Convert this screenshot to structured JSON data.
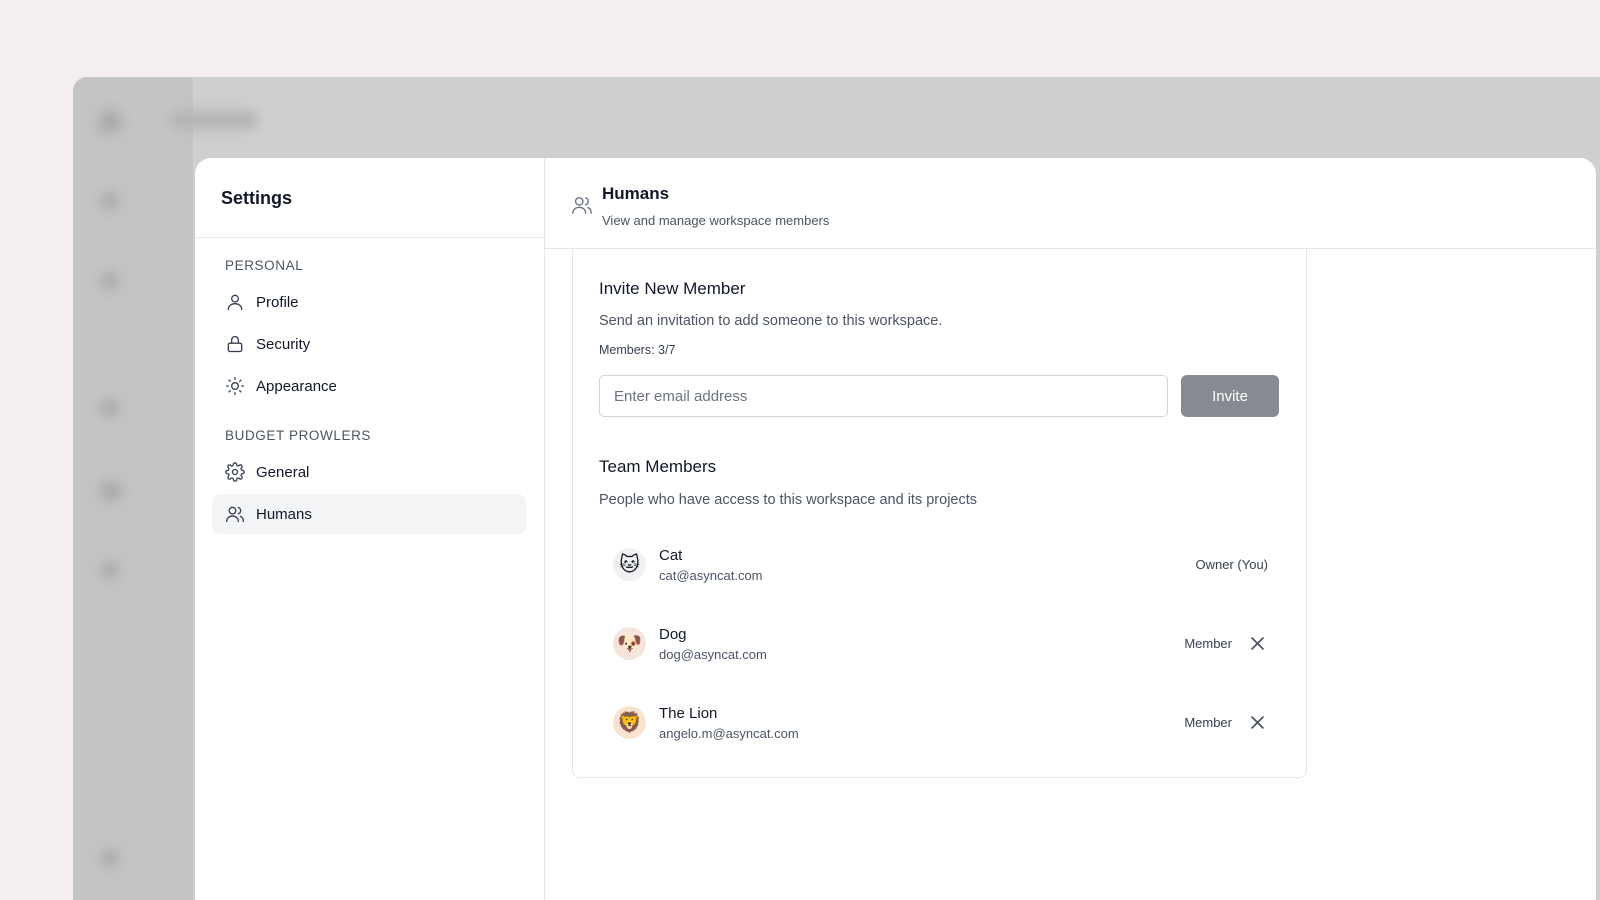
{
  "settings": {
    "title": "Settings",
    "sections": [
      {
        "label": "PERSONAL",
        "items": [
          {
            "label": "Profile",
            "icon": "user-icon"
          },
          {
            "label": "Security",
            "icon": "lock-icon"
          },
          {
            "label": "Appearance",
            "icon": "sun-icon"
          }
        ]
      },
      {
        "label": "BUDGET PROWLERS",
        "items": [
          {
            "label": "General",
            "icon": "gear-icon"
          },
          {
            "label": "Humans",
            "icon": "users-icon",
            "active": true
          }
        ]
      }
    ]
  },
  "header": {
    "title": "Humans",
    "subtitle": "View and manage workspace members",
    "icon": "users-icon"
  },
  "invite": {
    "title": "Invite New Member",
    "subtitle": "Send an invitation to add someone to this workspace.",
    "count": "Members: 3/7",
    "placeholder": "Enter email address",
    "value": "",
    "button_label": "Invite",
    "button_color": "#878a91"
  },
  "team": {
    "title": "Team Members",
    "subtitle": "People who have access to this workspace and its projects",
    "members": [
      {
        "name": "Cat",
        "email": "cat@asyncat.com",
        "role": "Owner (You)",
        "avatar": "🐱",
        "removable": false
      },
      {
        "name": "Dog",
        "email": "dog@asyncat.com",
        "role": "Member",
        "avatar": "🐶",
        "removable": true
      },
      {
        "name": "The Lion",
        "email": "angelo.m@asyncat.com",
        "role": "Member",
        "avatar": "🦁",
        "removable": true
      }
    ]
  }
}
